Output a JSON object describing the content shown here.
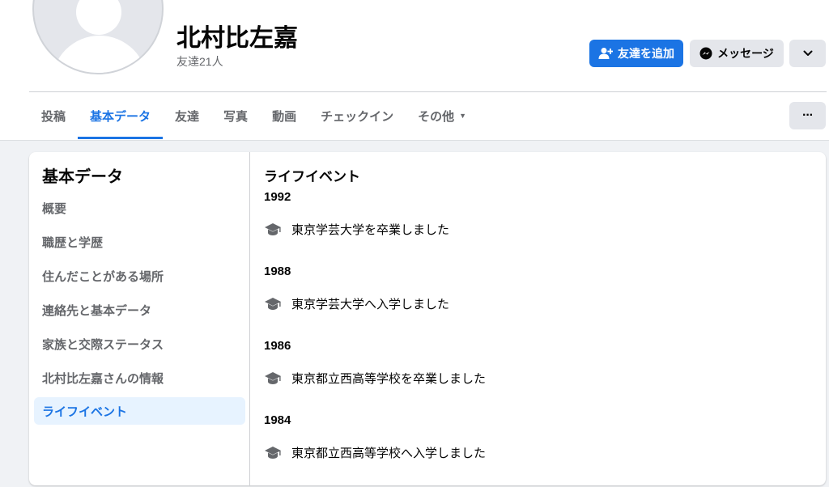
{
  "profile": {
    "name": "北村比左嘉",
    "friends_count": "友達21人"
  },
  "actions": {
    "add_friend": "友達を追加",
    "message": "メッセージ"
  },
  "tabs": [
    {
      "label": "投稿"
    },
    {
      "label": "基本データ",
      "active": true
    },
    {
      "label": "友達"
    },
    {
      "label": "写真"
    },
    {
      "label": "動画"
    },
    {
      "label": "チェックイン"
    },
    {
      "label": "その他"
    }
  ],
  "sidebar": {
    "title": "基本データ",
    "items": [
      {
        "label": "概要"
      },
      {
        "label": "職歴と学歴"
      },
      {
        "label": "住んだことがある場所"
      },
      {
        "label": "連絡先と基本データ"
      },
      {
        "label": "家族と交際ステータス"
      },
      {
        "label": "北村比左嘉さんの情報"
      },
      {
        "label": "ライフイベント",
        "active": true
      }
    ]
  },
  "life_events": {
    "title": "ライフイベント",
    "groups": [
      {
        "year": "1992",
        "event": "東京学芸大学を卒業しました",
        "icon": "graduation-cap-icon"
      },
      {
        "year": "1988",
        "event": "東京学芸大学へ入学しました",
        "icon": "graduation-cap-icon"
      },
      {
        "year": "1986",
        "event": "東京都立西高等学校を卒業しました",
        "icon": "graduation-cap-icon"
      },
      {
        "year": "1984",
        "event": "東京都立西高等学校へ入学しました",
        "icon": "graduation-cap-icon"
      }
    ]
  },
  "colors": {
    "accent": "#1b74e4",
    "background": "#f0f2f5",
    "secondary_text": "#65676b"
  }
}
